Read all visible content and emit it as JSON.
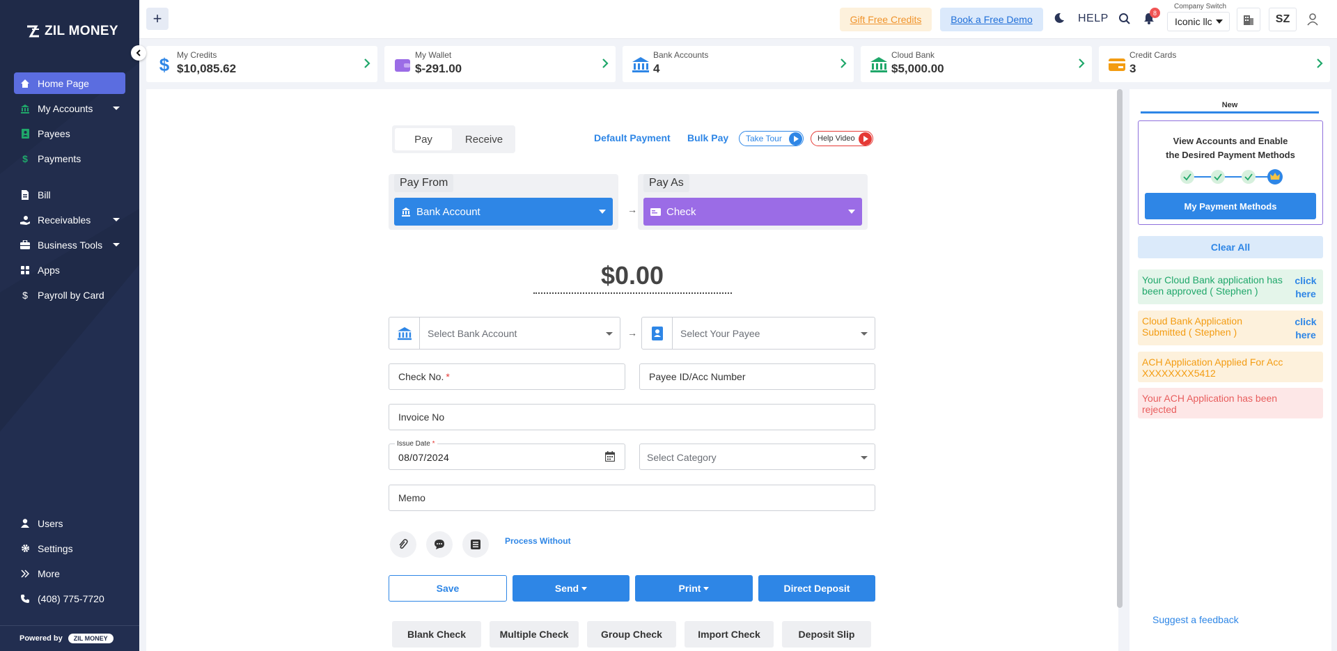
{
  "sidebar": {
    "logo": "ZIL MONEY",
    "items": [
      {
        "label": "Home Page",
        "icon": "home-icon",
        "active": true,
        "has_caret": false
      },
      {
        "label": "My Accounts",
        "icon": "bank-icon",
        "has_caret": true
      },
      {
        "label": "Payees",
        "icon": "contact-book-icon",
        "has_caret": false
      },
      {
        "label": "Payments",
        "icon": "dollar-icon",
        "has_caret": false
      },
      {
        "label": "Bill",
        "icon": "bill-icon",
        "has_caret": false
      },
      {
        "label": "Receivables",
        "icon": "receive-hand-icon",
        "has_caret": true
      },
      {
        "label": "Business Tools",
        "icon": "briefcase-icon",
        "has_caret": true
      },
      {
        "label": "Apps",
        "icon": "apps-grid-icon",
        "has_caret": false
      },
      {
        "label": "Payroll by Card",
        "icon": "dollar-icon",
        "has_caret": false
      }
    ],
    "bottom_items": [
      {
        "label": "Users",
        "icon": "user-icon"
      },
      {
        "label": "Settings",
        "icon": "gear-icon"
      },
      {
        "label": "More",
        "icon": "double-chevron-right-icon"
      },
      {
        "label": "(408) 775-7720",
        "icon": "phone-icon"
      }
    ],
    "powered_by": "Powered by",
    "powered_logo": "ZIL MONEY"
  },
  "topbar": {
    "plus": "+",
    "gift_credits": "Gift Free Credits",
    "book_demo": "Book a Free Demo",
    "help": "HELP",
    "notification_count": "8",
    "company_switch_label": "Company Switch",
    "company_name": "Iconic llc",
    "user_initials": "SZ"
  },
  "summary_cards": [
    {
      "label": "My Credits",
      "value": "$10,085.62",
      "icon": "dollar-sign-icon",
      "color": "#2e86e6"
    },
    {
      "label": "My Wallet",
      "value": "$-291.00",
      "icon": "wallet-icon",
      "color": "#9b6ce6"
    },
    {
      "label": "Bank Accounts",
      "value": "4",
      "icon": "bank-icon",
      "color": "#2e86e6"
    },
    {
      "label": "Cloud Bank",
      "value": "$5,000.00",
      "icon": "bank-icon",
      "color": "#1fa76a"
    },
    {
      "label": "Credit Cards",
      "value": "3",
      "icon": "credit-card-icon",
      "color": "#f39c12"
    }
  ],
  "payment": {
    "tabs": [
      "Pay",
      "Receive"
    ],
    "default_payment": "Default Payment",
    "bulk_pay": "Bulk Pay",
    "take_tour": "Take Tour",
    "help_video": "Help Video",
    "pay_from_title": "Pay From",
    "pay_from_value": "Bank Account",
    "pay_as_title": "Pay As",
    "pay_as_value": "Check",
    "amount": "$0.00",
    "select_bank_placeholder": "Select Bank Account",
    "select_payee_placeholder": "Select Your Payee",
    "check_no": "Check No.",
    "payee_id": "Payee ID/Acc Number",
    "invoice_no": "Invoice No",
    "issue_date_label": "Issue Date",
    "issue_date": "08/07/2024",
    "category_placeholder": "Select Category",
    "memo": "Memo",
    "process_without": "Process Without",
    "save": "Save",
    "send": "Send",
    "print": "Print",
    "direct_deposit": "Direct Deposit",
    "bottom_buttons": [
      "Blank Check",
      "Multiple Check",
      "Group Check",
      "Import Check",
      "Deposit Slip"
    ]
  },
  "right_panel": {
    "tab": "New",
    "promo_title_line1": "View Accounts and Enable",
    "promo_title_line2": "the Desired Payment Methods",
    "promo_button": "My Payment Methods",
    "clear_all": "Clear All",
    "notifications": [
      {
        "message": "Your Cloud Bank application has been approved ( Stephen )",
        "action": "click here",
        "bg": "#e4f5ea",
        "color": "#1fa76a"
      },
      {
        "message": "Cloud Bank Application Submitted ( Stephen )",
        "action": "click here",
        "bg": "#fdf1dc",
        "color": "#f39c12"
      },
      {
        "message": "ACH Application Applied For Acc XXXXXXXX5412",
        "bg": "#fdf1dc",
        "color": "#f39c12"
      },
      {
        "message": "Your ACH Application has been rejected",
        "bg": "#fde7e7",
        "color": "#e85d5d"
      }
    ],
    "feedback": "Suggest a feedback"
  },
  "colors": {
    "sidebar_bg": "#1f2a48",
    "accent": "#2e86e6",
    "active_nav": "#5b6de0",
    "pay_as": "#9b6ce6"
  }
}
